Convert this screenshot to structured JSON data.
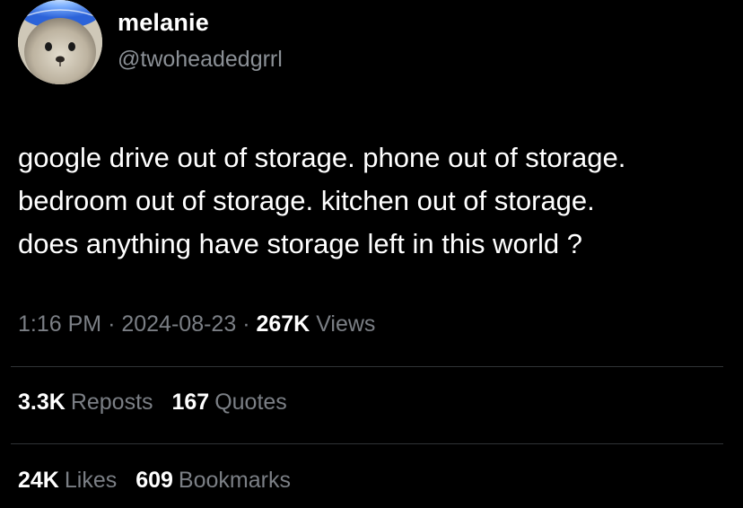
{
  "author": {
    "display_name": "melanie",
    "handle": "@twoheadedgrrl",
    "avatar_icon": "seal-pup-avatar"
  },
  "tweet": {
    "text": "google drive out of storage. phone out of storage.\nbedroom out of storage.  kitchen out of storage.\ndoes anything have storage left in this world ?"
  },
  "meta": {
    "time": "1:16 PM",
    "separator": "·",
    "date": "2024-08-23",
    "views_count": "267K",
    "views_label": "Views"
  },
  "stats": {
    "reposts_count": "3.3K",
    "reposts_label": "Reposts",
    "quotes_count": "167",
    "quotes_label": "Quotes",
    "likes_count": "24K",
    "likes_label": "Likes",
    "bookmarks_count": "609",
    "bookmarks_label": "Bookmarks"
  },
  "colors": {
    "background": "#000000",
    "primary_text": "#ffffff",
    "secondary_text": "#7b7f85",
    "divider": "#2f3336"
  }
}
